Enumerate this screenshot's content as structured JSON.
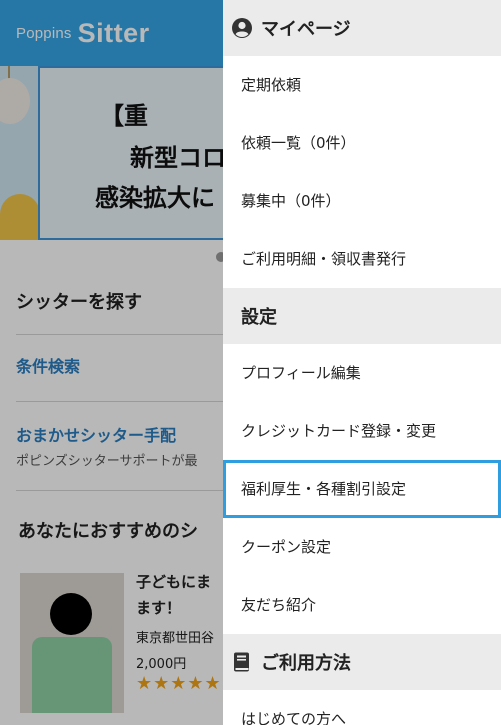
{
  "header": {
    "logo_small": "Poppins",
    "logo_big": "Sitter"
  },
  "banner": {
    "line1": "【重",
    "line2": "新型コロ",
    "line3": "感染拡大に"
  },
  "page": {
    "find_sitter_title": "シッターを探す",
    "condition_search": "条件検索",
    "omakase_title": "おまかせシッター手配",
    "omakase_sub": "ポピンズシッターサポートが最",
    "recommend_title": "あなたにおすすめのシ",
    "card": {
      "title_line1": "子どもにま",
      "title_line2": "ます！",
      "location": "東京都世田谷",
      "price": "2,000円",
      "stars": "★★★★★"
    }
  },
  "menu": {
    "mypage_header": "マイページ",
    "items_mypage": [
      "定期依頼",
      "依頼一覧（0件）",
      "募集中（0件）",
      "ご利用明細・領収書発行"
    ],
    "settings_header": "設定",
    "items_settings": [
      "プロフィール編集",
      "クレジットカード登録・変更",
      "福利厚生・各種割引設定",
      "クーポン設定",
      "友だち紹介"
    ],
    "usage_header": "ご利用方法",
    "items_usage": [
      "はじめての方へ"
    ]
  },
  "colors": {
    "brand": "#35a6e6",
    "link": "#2a7dc0",
    "selection": "#2f9ee0"
  }
}
